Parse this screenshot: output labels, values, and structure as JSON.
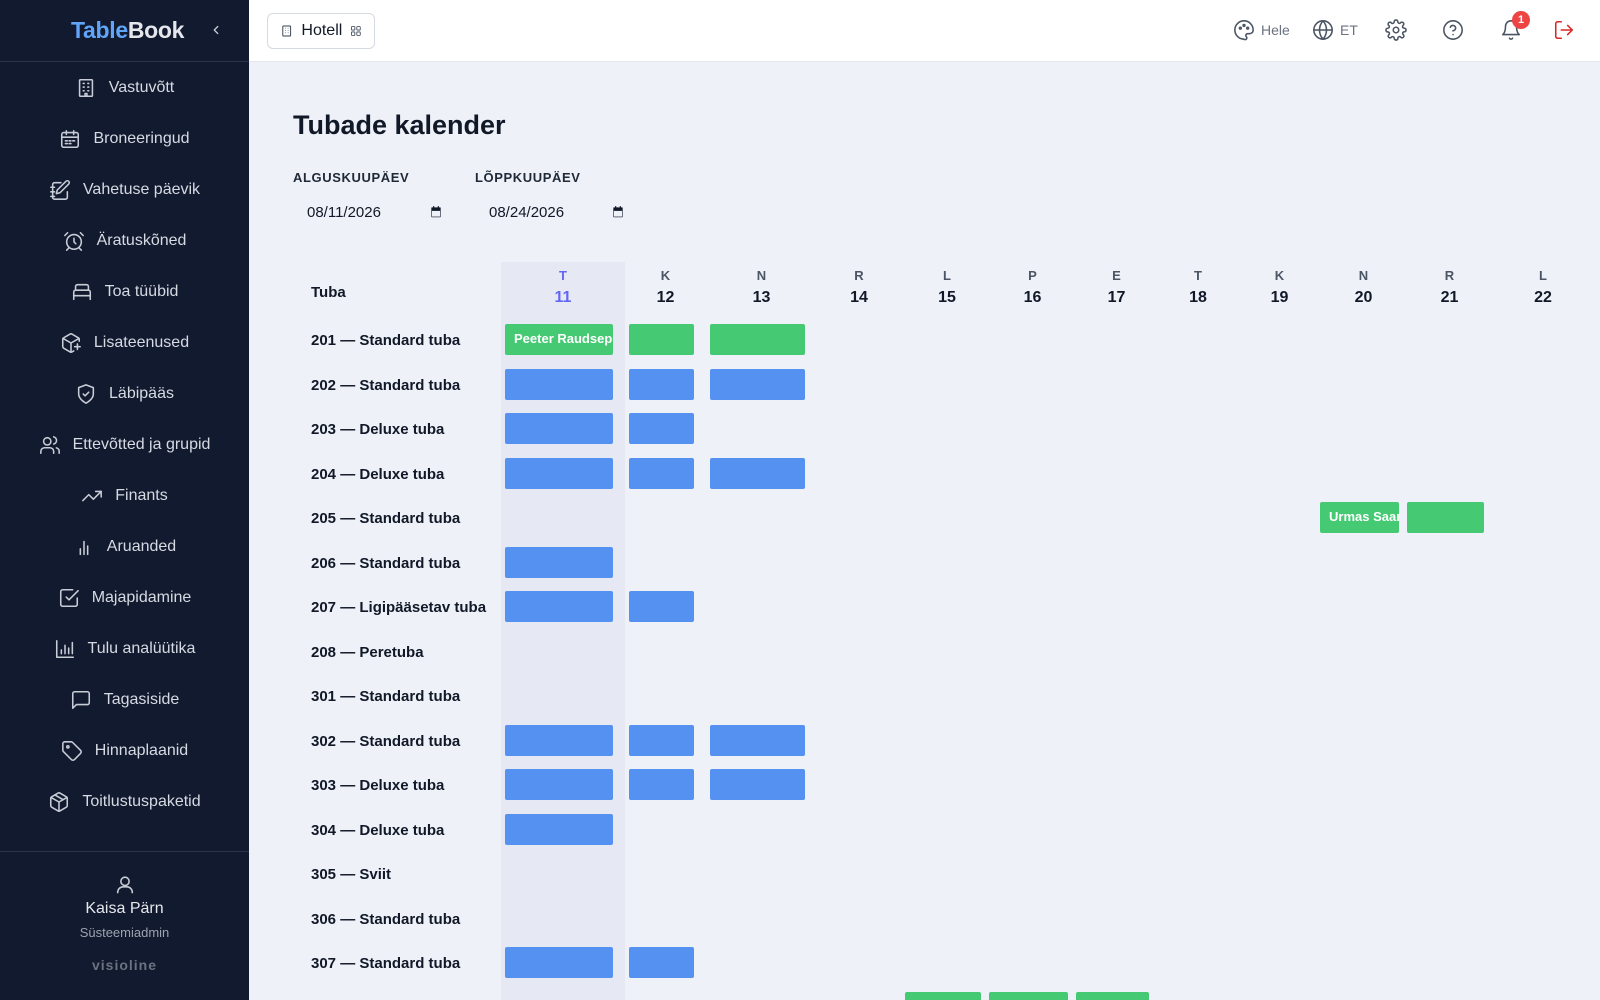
{
  "brand": {
    "part1": "Table",
    "part2": "Book"
  },
  "sidebar": {
    "items": [
      {
        "label": "Vastuvõtt",
        "icon": "building-icon"
      },
      {
        "label": "Broneeringud",
        "icon": "calendar-icon"
      },
      {
        "label": "Vahetuse päevik",
        "icon": "notebook-pen-icon"
      },
      {
        "label": "Äratuskõned",
        "icon": "alarm-clock-icon"
      },
      {
        "label": "Toa tüübid",
        "icon": "bed-icon"
      },
      {
        "label": "Lisateenused",
        "icon": "package-plus-icon"
      },
      {
        "label": "Läbipääs",
        "icon": "shield-check-icon"
      },
      {
        "label": "Ettevõtted ja grupid",
        "icon": "users-icon"
      },
      {
        "label": "Finants",
        "icon": "trending-up-icon"
      },
      {
        "label": "Aruanded",
        "icon": "bar-chart-icon"
      },
      {
        "label": "Majapidamine",
        "icon": "check-square-icon"
      },
      {
        "label": "Tulu analüütika",
        "icon": "analytics-chart-icon"
      },
      {
        "label": "Tagasiside",
        "icon": "message-square-icon"
      },
      {
        "label": "Hinnaplaanid",
        "icon": "tag-icon"
      },
      {
        "label": "Toitlustuspaketid",
        "icon": "box-icon"
      }
    ],
    "user": {
      "name": "Kaisa Pärn",
      "role": "Süsteemiadmin"
    },
    "vendor": "visioline"
  },
  "topbar": {
    "module": "Hotell",
    "theme": "Hele",
    "language": "ET",
    "notifications_count": "1"
  },
  "page": {
    "title": "Tubade kalender",
    "start_label": "ALGUSKUUPÄEV",
    "start_value": "08/11/2026",
    "end_label": "LÕPPKUUPÄEV",
    "end_value": "08/24/2026"
  },
  "calendar": {
    "room_header": "Tuba",
    "today_index": 0,
    "days": [
      {
        "dow": "T",
        "num": "11"
      },
      {
        "dow": "K",
        "num": "12"
      },
      {
        "dow": "N",
        "num": "13"
      },
      {
        "dow": "R",
        "num": "14"
      },
      {
        "dow": "L",
        "num": "15"
      },
      {
        "dow": "P",
        "num": "16"
      },
      {
        "dow": "E",
        "num": "17"
      },
      {
        "dow": "T",
        "num": "18"
      },
      {
        "dow": "K",
        "num": "19"
      },
      {
        "dow": "N",
        "num": "20"
      },
      {
        "dow": "R",
        "num": "21"
      },
      {
        "dow": "L",
        "num": "22"
      }
    ],
    "rooms": [
      "201 — Standard tuba",
      "202 — Standard tuba",
      "203 — Deluxe tuba",
      "204 — Deluxe tuba",
      "205 — Standard tuba",
      "206 — Standard tuba",
      "207 — Ligipääsetav tuba",
      "208 — Peretuba",
      "301 — Standard tuba",
      "302 — Standard tuba",
      "303 — Deluxe tuba",
      "304 — Deluxe tuba",
      "305 — Sviit",
      "306 — Standard tuba",
      "307 — Standard tuba"
    ],
    "bookings": [
      {
        "room": 0,
        "days": [
          0,
          1,
          2
        ],
        "status": "green",
        "label": "Peeter Raudsepp"
      },
      {
        "room": 1,
        "days": [
          0,
          1,
          2
        ],
        "status": "blue",
        "label": ""
      },
      {
        "room": 2,
        "days": [
          0,
          1
        ],
        "status": "blue",
        "label": ""
      },
      {
        "room": 3,
        "days": [
          0,
          1,
          2
        ],
        "status": "blue",
        "label": ""
      },
      {
        "room": 4,
        "days": [
          9,
          10
        ],
        "status": "green",
        "label": "Urmas Saar"
      },
      {
        "room": 5,
        "days": [
          0
        ],
        "status": "blue",
        "label": ""
      },
      {
        "room": 6,
        "days": [
          0,
          1
        ],
        "status": "blue",
        "label": ""
      },
      {
        "room": 9,
        "days": [
          0,
          1,
          2
        ],
        "status": "blue",
        "label": ""
      },
      {
        "room": 10,
        "days": [
          0,
          1,
          2
        ],
        "status": "blue",
        "label": ""
      },
      {
        "room": 11,
        "days": [
          0
        ],
        "status": "blue",
        "label": ""
      },
      {
        "room": 14,
        "days": [
          0,
          1
        ],
        "status": "blue",
        "label": ""
      },
      {
        "room": 15,
        "days": [
          4,
          5,
          6
        ],
        "status": "green",
        "label": ""
      }
    ]
  },
  "colors": {
    "booked_blue": "#5591f1",
    "checked_in_green": "#45c973",
    "today_accent": "#6366f1"
  }
}
